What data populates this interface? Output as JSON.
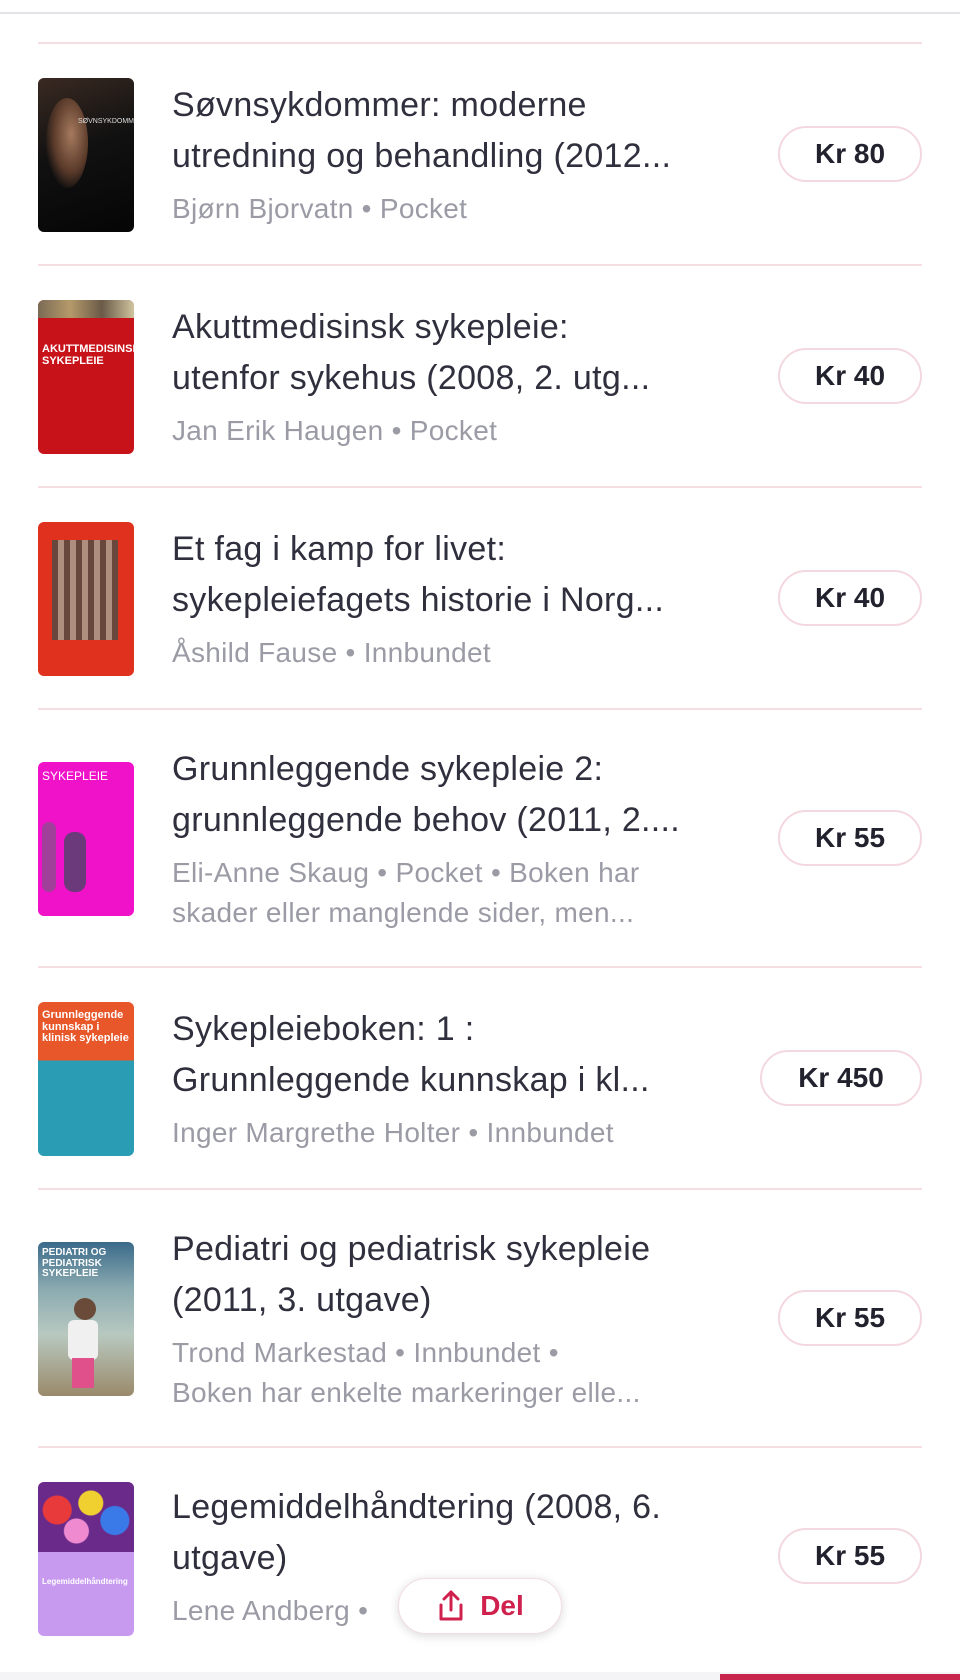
{
  "items": [
    {
      "title_lines": [
        "Søvnsykdommer: moderne",
        "utredning og behandling (2012..."
      ],
      "meta_lines": [
        "Bjørn Bjorvatn • Pocket"
      ],
      "price": "Kr 80",
      "cover_text": "SØVNSYKDOMMER"
    },
    {
      "title_lines": [
        "Akuttmedisinsk sykepleie:",
        "utenfor sykehus (2008, 2. utg..."
      ],
      "meta_lines": [
        "Jan Erik Haugen • Pocket"
      ],
      "price": "Kr 40",
      "cover_text": "AKUTTMEDISINSK SYKEPLEIE"
    },
    {
      "title_lines": [
        "Et fag i kamp for livet:",
        "sykepleiefagets historie i Norg..."
      ],
      "meta_lines": [
        "Åshild Fause • Innbundet"
      ],
      "price": "Kr 40",
      "cover_text": ""
    },
    {
      "title_lines": [
        "Grunnleggende sykepleie 2:",
        "grunnleggende behov (2011, 2...."
      ],
      "meta_lines": [
        "Eli-Anne Skaug • Pocket • Boken har",
        "skader eller manglende sider, men..."
      ],
      "price": "Kr 55",
      "cover_text": "SYKEPLEIE"
    },
    {
      "title_lines": [
        "Sykepleieboken: 1 :",
        "Grunnleggende kunnskap i kl..."
      ],
      "meta_lines": [
        "Inger Margrethe Holter • Innbundet"
      ],
      "price": "Kr 450",
      "cover_text": "Grunnleggende kunnskap i klinisk sykepleie"
    },
    {
      "title_lines": [
        "Pediatri og pediatrisk sykepleie",
        "(2011, 3. utgave)"
      ],
      "meta_lines": [
        "Trond Markestad • Innbundet •",
        "Boken har enkelte markeringer elle..."
      ],
      "price": "Kr 55",
      "cover_text": "PEDIATRI OG PEDIATRISK SYKEPLEIE"
    },
    {
      "title_lines": [
        "Legemiddelhåndtering (2008, 6.",
        "utgave)"
      ],
      "meta_lines": [
        "Lene Andberg •"
      ],
      "price": "Kr 55",
      "cover_text": "Legemiddelhåndtering"
    }
  ],
  "share": {
    "label": "Del",
    "icon": "share-icon"
  },
  "colors": {
    "accent": "#d0214e",
    "separator": "#f6dde2",
    "meta_text": "#9b9ba6"
  }
}
